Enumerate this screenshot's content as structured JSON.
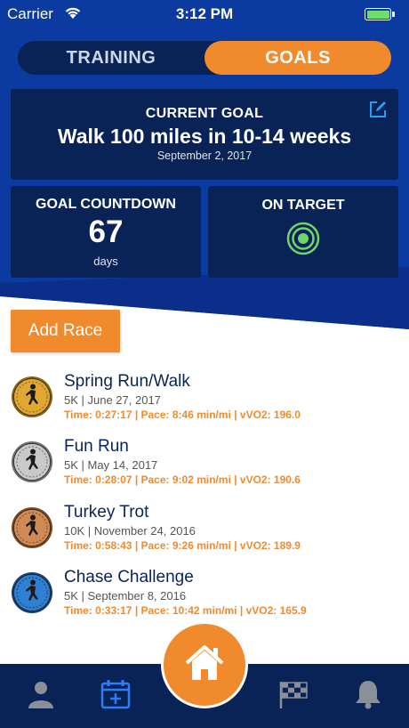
{
  "status": {
    "carrier": "Carrier",
    "time": "3:12 PM"
  },
  "tabs": {
    "training": "TRAINING",
    "goals": "GOALS",
    "active": "goals"
  },
  "goal": {
    "label": "CURRENT GOAL",
    "title": "Walk 100 miles in 10-14 weeks",
    "date": "September 2, 2017"
  },
  "countdown": {
    "label": "GOAL COUNTDOWN",
    "value": "67",
    "unit": "days"
  },
  "target": {
    "label": "ON TARGET"
  },
  "add_race": "Add Race",
  "races": [
    {
      "name": "Spring Run/Walk",
      "meta": "5K | June 27, 2017",
      "stats": "Time: 0:27:17 | Pace: 8:46 min/mi | vVO2: 196.0",
      "medal": "gold-medal-icon"
    },
    {
      "name": "Fun Run",
      "meta": "5K | May 14, 2017",
      "stats": "Time: 0:28:07 | Pace: 9:02 min/mi | vVO2: 190.6",
      "medal": "silver-medal-icon"
    },
    {
      "name": "Turkey Trot",
      "meta": "10K | November 24, 2016",
      "stats": "Time: 0:58:43 | Pace: 9:26 min/mi | vVO2: 189.9",
      "medal": "bronze-medal-icon"
    },
    {
      "name": "Chase Challenge",
      "meta": "5K | September 8, 2016",
      "stats": "Time: 0:33:17 | Pace: 10:42 min/mi | vVO2: 165.9",
      "medal": "blue-medal-icon"
    }
  ],
  "colors": {
    "primary": "#0b3aa0",
    "card": "#0a2356",
    "accent": "#f08a2c",
    "target_green": "#6fd66a",
    "active_tab_icon": "#2d7df6"
  },
  "tabbar": {
    "items": [
      "profile-icon",
      "calendar-add-icon",
      "home-icon",
      "checkered-flag-icon",
      "bell-icon"
    ],
    "active": "calendar-add-icon"
  }
}
